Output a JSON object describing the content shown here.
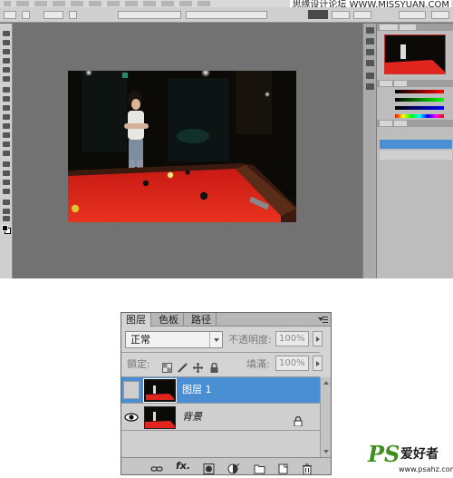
{
  "watermark_top": "思缘设计论坛  WWW.MISSYUAN.COM",
  "layers_panel": {
    "tabs": [
      "图层",
      "色板",
      "路径"
    ],
    "blend_mode": "正常",
    "opacity_label": "不透明度:",
    "opacity_value": "100%",
    "lock_label": "鎖定:",
    "fill_label": "填滿:",
    "fill_value": "100%",
    "layers": [
      {
        "name": "图层 1",
        "selected": true,
        "visible": false
      },
      {
        "name": "背景",
        "selected": false,
        "visible": true,
        "locked": true
      }
    ],
    "footer_icons": [
      "link-icon",
      "fx-icon",
      "mask-icon",
      "adjustment-icon",
      "group-folder-icon",
      "new-layer-icon",
      "trash-icon"
    ],
    "footer_fx": "fx."
  },
  "brand": {
    "logo": "PS",
    "name": "爱好者",
    "url": "www.psahz.com"
  },
  "colors": {
    "selected_row": "#4a8fd4",
    "table_felt": "#e0261e",
    "brand_green": "#3c8f1c"
  }
}
